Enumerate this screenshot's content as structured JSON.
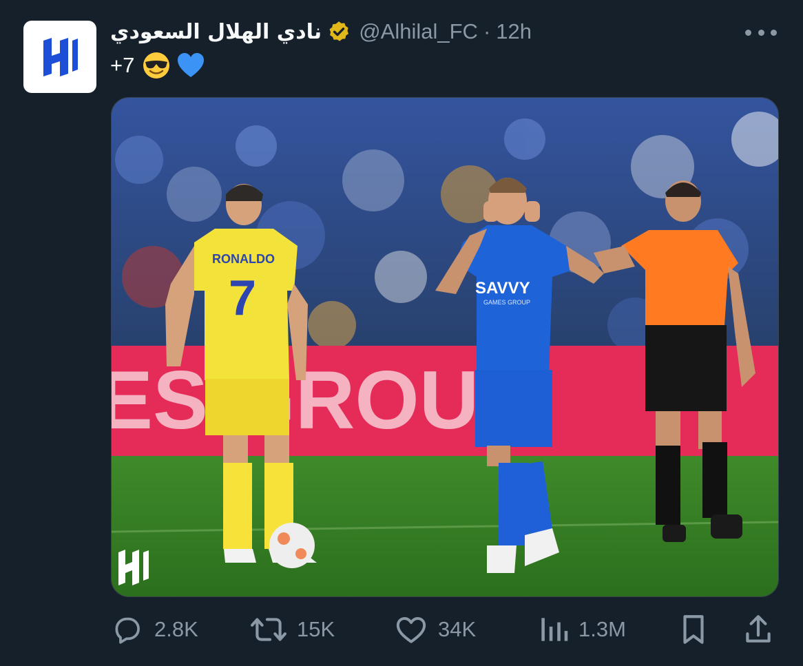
{
  "tweet": {
    "display_name": "نادي الهلال السعودي",
    "handle": "@Alhilal_FC",
    "separator": "·",
    "time": "12h",
    "text": "+7",
    "emojis": [
      "smiling-face-with-sunglasses",
      "blue-heart"
    ],
    "verified_color": "#e2b719"
  },
  "media": {
    "shirt_name": "RONALDO",
    "shirt_number": "7",
    "sponsor": "SAVVY",
    "sponsor_sub": "GAMES GROUP",
    "board_text": "ES GROUP",
    "watermark_logo": "alhilal-logo"
  },
  "actions": {
    "reply_count": "2.8K",
    "retweet_count": "15K",
    "like_count": "34K",
    "views_count": "1.3M"
  },
  "colors": {
    "background": "#15202b",
    "secondary_text": "#8b98a5",
    "alhilal_blue": "#1d4ed8",
    "nassr_yellow": "#f2e23a",
    "referee_orange": "#ff7a21"
  }
}
